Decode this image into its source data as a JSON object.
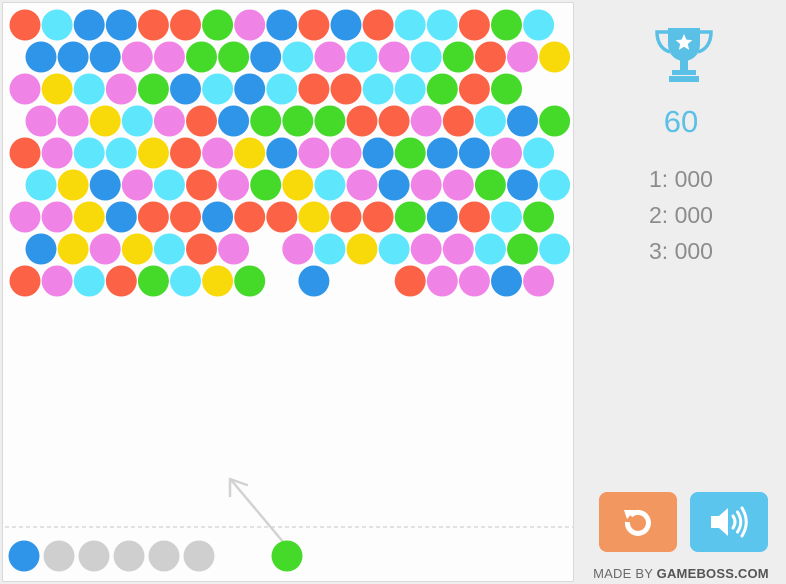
{
  "game": {
    "bubble_colors": {
      "R": "#fc6245",
      "C": "#5ee6fc",
      "B": "#2f95e8",
      "G": "#45d92a",
      "P": "#f083e6",
      "Y": "#f8d90a",
      "X": "#cfcfcf"
    },
    "grid_rows": [
      "RCBBRRGPBRBRCCRGC",
      "BBBPPGGBCPCPCGRPY",
      "PYCPGBCBCRRCCGRG",
      "PPYCPRBGGGRRPRCBG",
      "RPCCYRPYBPPBGBBPC",
      "CYBPCRPGYCPBPPGBC",
      "PPYBRRBRRYRRGBRCG",
      "BYPYCRP.PCYCPPCGC",
      "RPCRGCYG.B..RPPBP"
    ],
    "queue": [
      "B",
      "X",
      "X",
      "X",
      "X",
      "X"
    ],
    "current_bubble": "G"
  },
  "sidebar": {
    "score": "60",
    "high_scores": [
      "1: 000",
      "2: 000",
      "3: 000"
    ],
    "icons": {
      "trophy": "trophy-icon",
      "restart": "restart-icon",
      "sound": "speaker-icon"
    },
    "button_colors": {
      "restart": "#f29760",
      "sound": "#5cc5ee"
    },
    "accent_color": "#5bc0e6"
  },
  "footer": {
    "made_by": "MADE BY",
    "brand": "GAMEBOSS.COM"
  }
}
